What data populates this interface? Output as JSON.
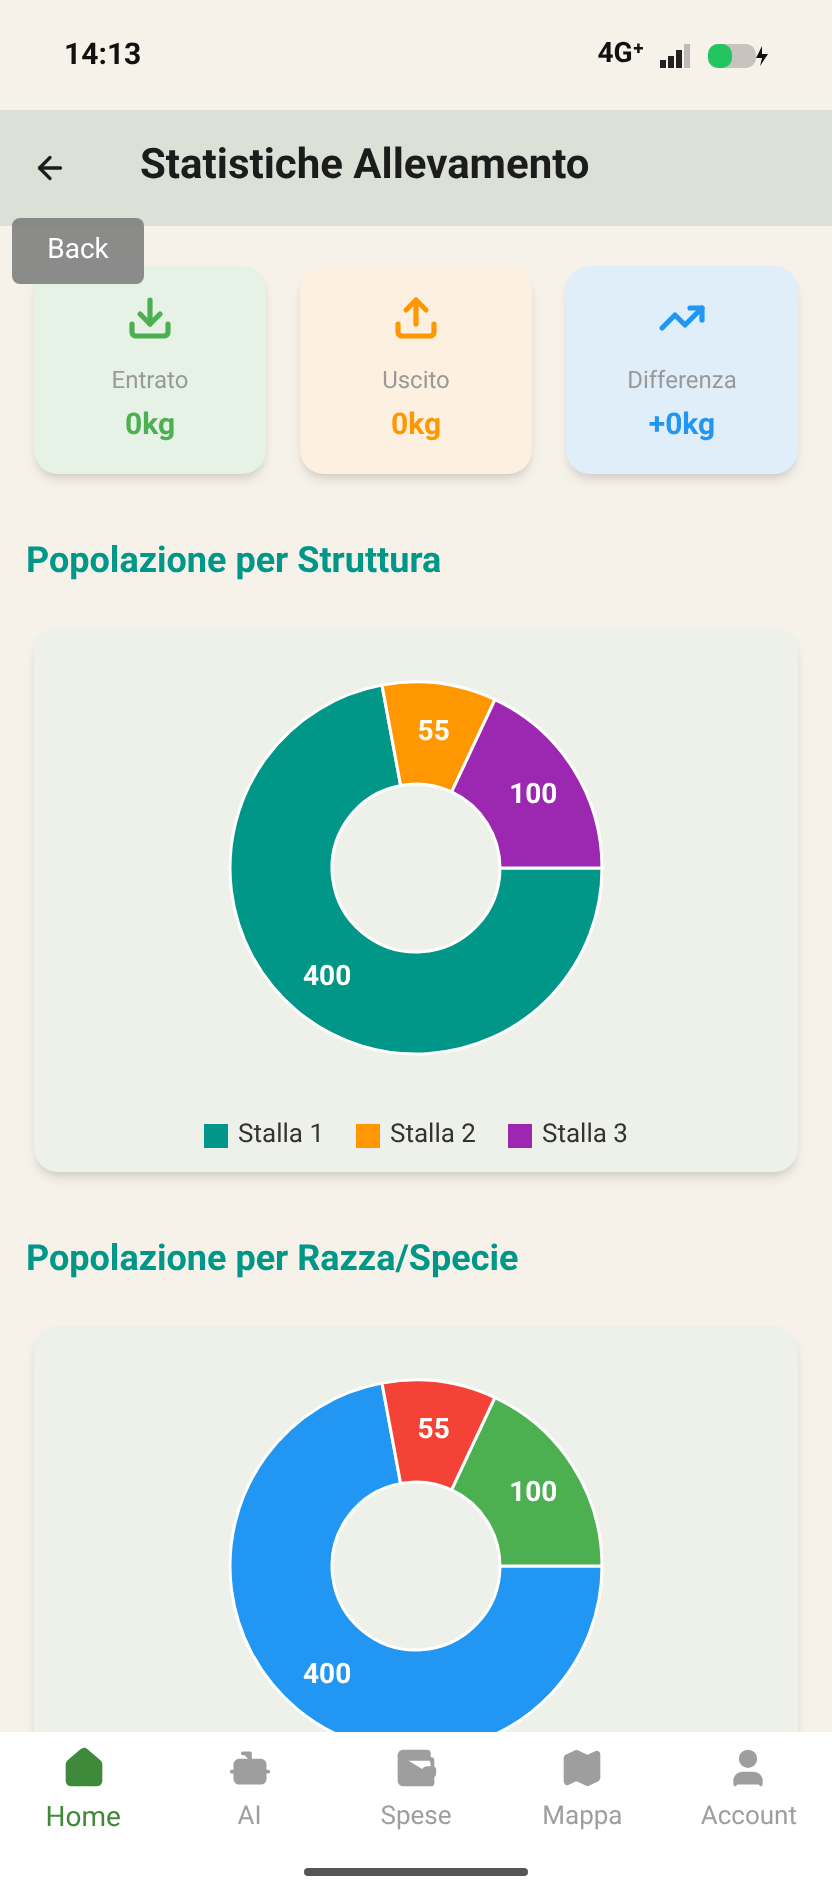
{
  "status_bar": {
    "time": "14:13",
    "network": "4G⁺"
  },
  "header": {
    "title": "Statistiche Allevamento",
    "tooltip": "Back"
  },
  "summary": [
    {
      "kind": "in",
      "label": "Entrato",
      "value": "0kg"
    },
    {
      "kind": "out",
      "label": "Uscito",
      "value": "0kg"
    },
    {
      "kind": "diff",
      "label": "Differenza",
      "value": "+0kg"
    }
  ],
  "sections": [
    {
      "title": "Popolazione per Struttura",
      "chart_data": {
        "type": "donut",
        "categories": [
          "Stalla 1",
          "Stalla 2",
          "Stalla 3"
        ],
        "series": [
          {
            "values": [
              400,
              55,
              100
            ]
          }
        ],
        "colors": [
          "#009688",
          "#ff9800",
          "#9c27b0"
        ],
        "data_labels": true
      }
    },
    {
      "title": "Popolazione per Razza/Specie",
      "chart_data": {
        "type": "donut",
        "series": [
          {
            "values": [
              400,
              55,
              100
            ]
          }
        ],
        "colors": [
          "#2196f3",
          "#f44336",
          "#4caf50"
        ],
        "data_labels": true
      }
    }
  ],
  "nav": [
    {
      "label": "Home",
      "selected": true
    },
    {
      "label": "AI",
      "selected": false
    },
    {
      "label": "Spese",
      "selected": false
    },
    {
      "label": "Mappa",
      "selected": false
    },
    {
      "label": "Account",
      "selected": false
    }
  ]
}
